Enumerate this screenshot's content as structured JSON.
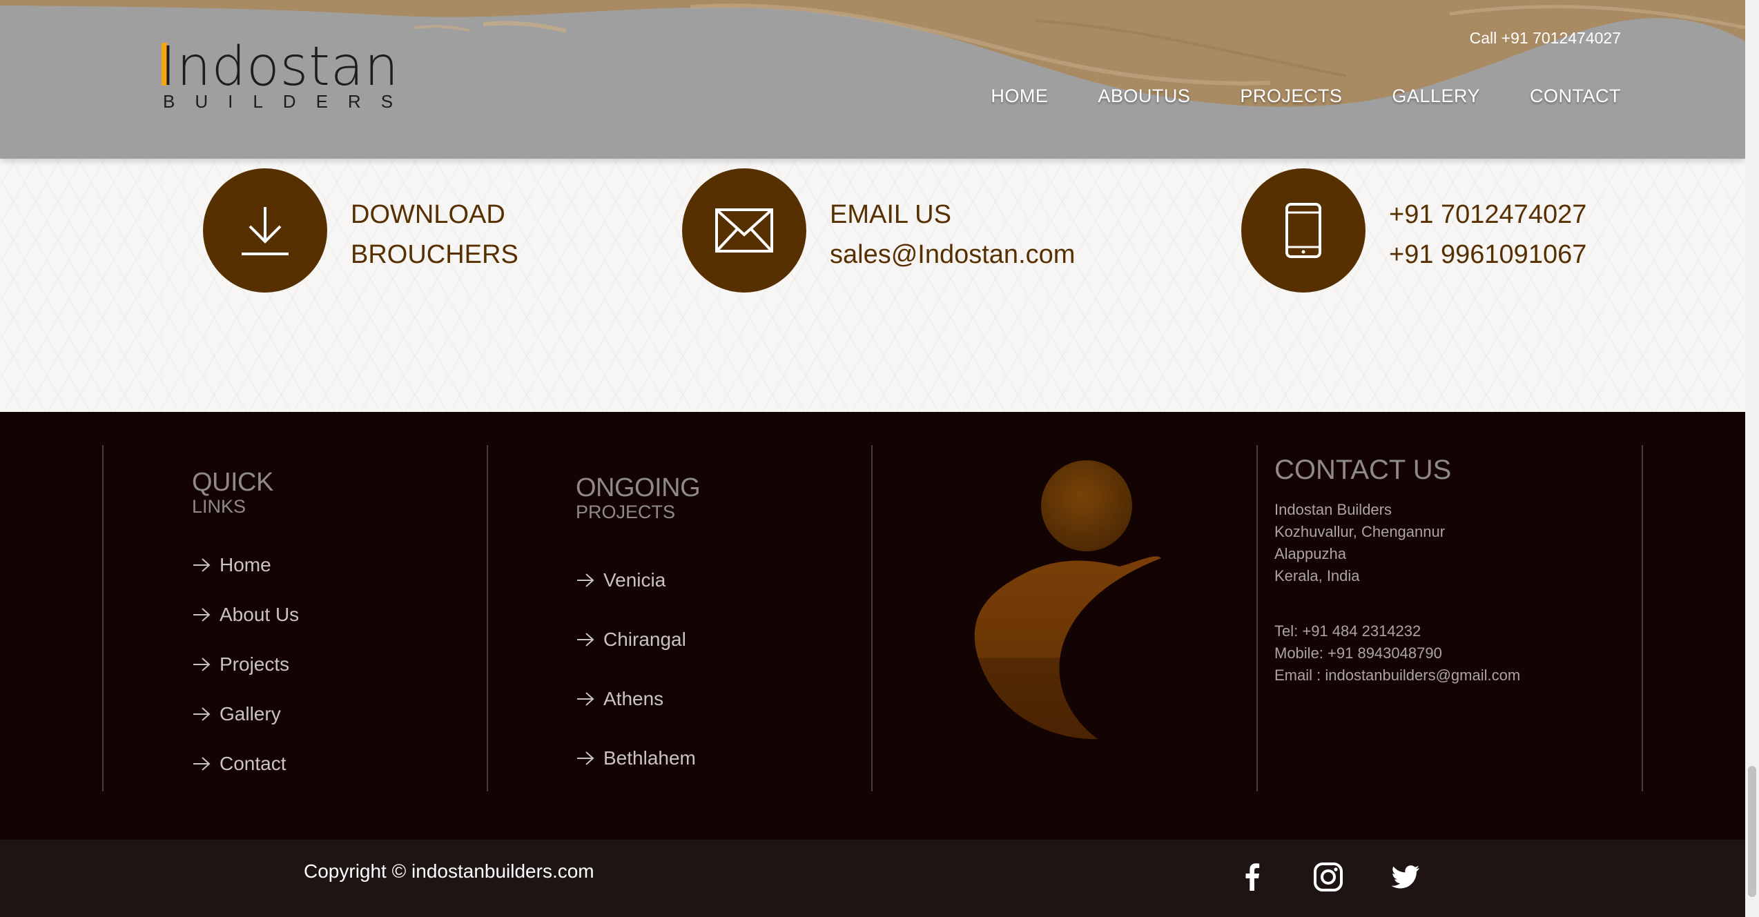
{
  "brand": {
    "logo_word": "Indostan",
    "logo_sub": "BUILDERS",
    "accent_color": "#f2a515"
  },
  "header": {
    "call": "Call +91 7012474027",
    "nav": [
      "HOME",
      "ABOUTUS",
      "PROJECTS",
      "GALLERY",
      "CONTACT"
    ]
  },
  "info": {
    "download": {
      "line1": "DOWNLOAD",
      "line2": "BROUCHERS",
      "icon": "download-icon"
    },
    "email": {
      "line1": "EMAIL US",
      "line2": "sales@Indostan.com",
      "icon": "envelope-icon"
    },
    "phone": {
      "line1": "+91 7012474027",
      "line2": "+91 9961091067",
      "icon": "mobile-phone-icon"
    },
    "circle_color": "#573001"
  },
  "footer": {
    "quick": {
      "title": "QUICK",
      "sub": "LINKS",
      "links": [
        "Home",
        "About Us",
        "Projects",
        "Gallery",
        "Contact"
      ]
    },
    "ongoing": {
      "title": "ONGOING",
      "sub": "PROJECTS",
      "links": [
        "Venicia",
        "Chirangal",
        "Athens",
        "Bethlahem"
      ]
    },
    "contact": {
      "title": "CONTACT US",
      "address": [
        "Indostan Builders",
        "Kozhuvallur, Chengannur",
        "Alappuzha",
        "Kerala, India"
      ],
      "tel": "Tel: +91 484 2314232",
      "mobile": "Mobile: +91 8943048790",
      "email": "Email : indostanbuilders@gmail.com"
    }
  },
  "bottom": {
    "copyright": "Copyright © indostanbuilders.com",
    "social": [
      "facebook-icon",
      "instagram-icon",
      "twitter-icon"
    ]
  }
}
